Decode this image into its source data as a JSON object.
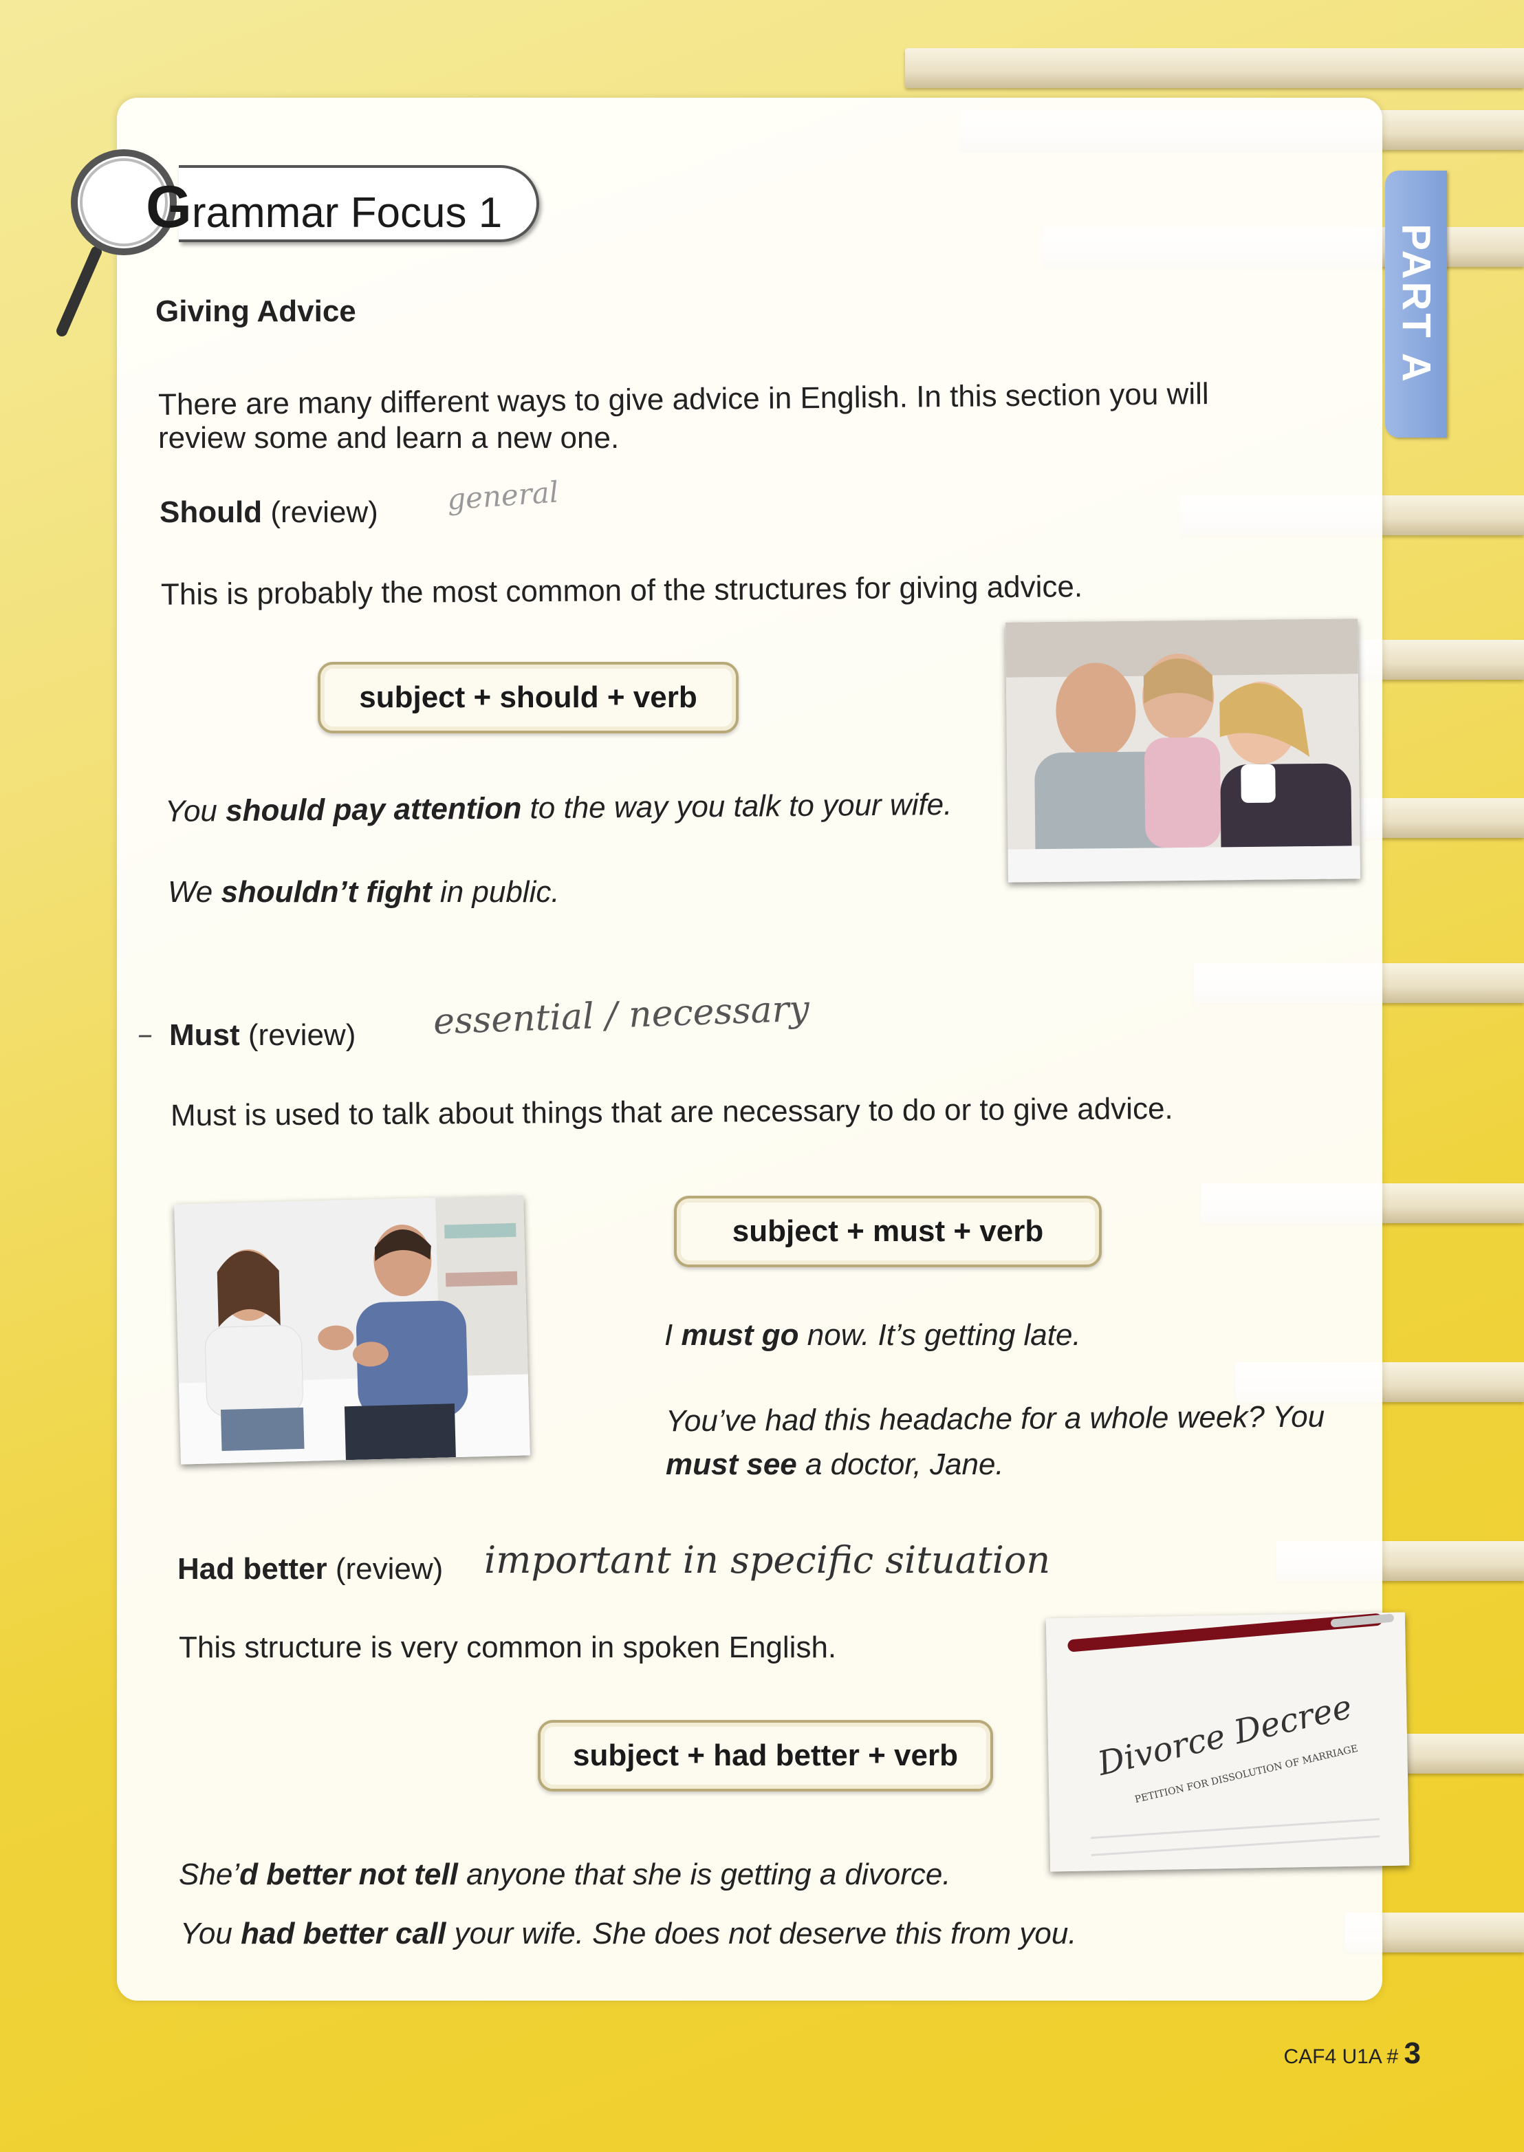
{
  "header": {
    "title_initial": "G",
    "title_rest": "rammar Focus 1",
    "tab": "PART A"
  },
  "section": {
    "heading": "Giving Advice",
    "intro_line1": "There are many different ways to give advice in English. In this section you will",
    "intro_line2": "review some and learn a new one."
  },
  "should": {
    "heading": "Should",
    "tag": "(review)",
    "handwritten": "general",
    "desc": "This is probably the most common of the structures for giving advice.",
    "formula": "subject + should + verb",
    "ex1": {
      "a": "You ",
      "b": "should pay attention",
      "c": " to the way you talk to your wife."
    },
    "ex2": {
      "a": "We ",
      "b": "shouldn’t fight",
      "c": " in public."
    }
  },
  "must": {
    "heading": "Must",
    "tag": "(review)",
    "handwritten": "essential / necessary",
    "desc": "Must is used to talk about things that are necessary to do or to give advice.",
    "formula": "subject + must + verb",
    "ex1": {
      "a": "I ",
      "b": "must go",
      "c": " now. It’s getting late."
    },
    "ex2": {
      "a": "You’ve had this headache for a whole week? You",
      "b": "must see",
      "c": " a doctor, Jane."
    }
  },
  "had_better": {
    "heading": "Had better",
    "tag": "(review)",
    "handwritten": "important in specific situation",
    "desc": "This structure is very common in spoken English.",
    "formula": "subject + had better + verb",
    "ex1": {
      "a": "She’",
      "b": "d better not tell",
      "c": " anyone that she is getting a divorce."
    },
    "ex2": {
      "a": "You ",
      "b": "had better call",
      "c": " your wife. She does not deserve this from you."
    }
  },
  "images": {
    "decree_title": "Divorce Decree",
    "decree_sub": "PETITION FOR DISSOLUTION OF MARRIAGE"
  },
  "footer": {
    "code": "CAF4 U1A # ",
    "page": "3"
  }
}
